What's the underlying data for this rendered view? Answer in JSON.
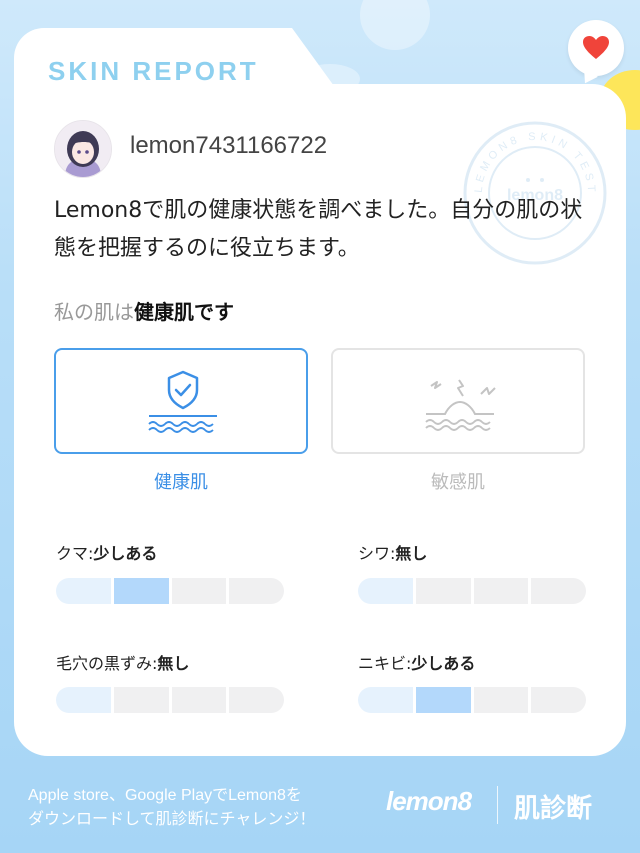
{
  "header": {
    "title": "SKIN REPORT"
  },
  "user": {
    "name": "lemon7431166722"
  },
  "stamp_text": "LEMON8 SKIN TEST",
  "description": "Lemon8で肌の健康状態を調べました。自分の肌の状態を把握するのに役立ちます。",
  "skin_result": {
    "prefix": "私の肌は",
    "type": "健康肌です"
  },
  "skin_types": [
    {
      "label": "健康肌",
      "icon": "shield-check-icon",
      "selected": true
    },
    {
      "label": "敏感肌",
      "icon": "irritation-icon",
      "selected": false
    }
  ],
  "metrics": [
    {
      "name": "クマ:",
      "value": "少しある",
      "level_index": 1,
      "segments": 4
    },
    {
      "name": "シワ:",
      "value": "無し",
      "level_index": 0,
      "segments": 4
    },
    {
      "name": "毛穴の黒ずみ:",
      "value": "無し",
      "level_index": 0,
      "segments": 4
    },
    {
      "name": "ニキビ:",
      "value": "少しある",
      "level_index": 1,
      "segments": 4
    }
  ],
  "footer": {
    "line1": "Apple store、Google PlayでLemon8を",
    "line2": "ダウンロードして肌診断にチャレンジ！",
    "logo": "lemon8",
    "feature": "肌診断"
  },
  "colors": {
    "accent": "#3b8fe6",
    "bar_on": "#b3d8fb",
    "heart": "#f0443a"
  }
}
